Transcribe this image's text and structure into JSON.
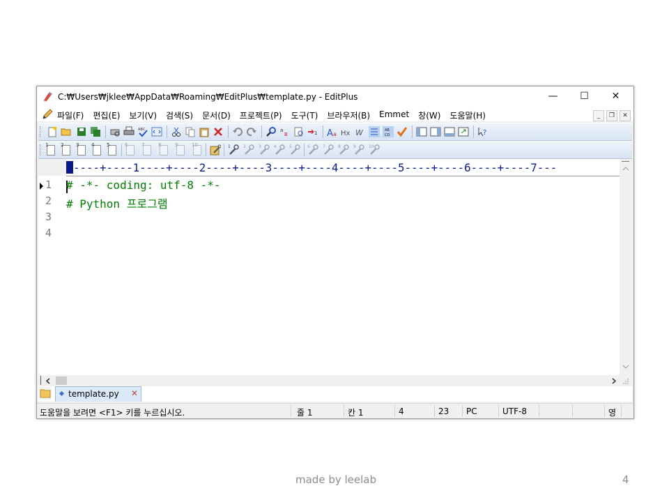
{
  "window": {
    "title": "C:₩Users₩jklee₩AppData₩Roaming₩EditPlus₩template.py - EditPlus",
    "controls": {
      "minimize": "—",
      "maximize": "☐",
      "close": "✕"
    }
  },
  "menubar": {
    "items": [
      "파일(F)",
      "편집(E)",
      "보기(V)",
      "검색(S)",
      "문서(D)",
      "프로젝트(P)",
      "도구(T)",
      "브라우저(B)",
      "Emmet",
      "창(W)",
      "도움말(H)"
    ],
    "mdi_controls": {
      "minimize": "_",
      "restore": "❐",
      "close": "✕"
    }
  },
  "toolbar2": {
    "doc_numbers": [
      "1",
      "2",
      "3",
      "4",
      "5",
      "6",
      "7",
      "8",
      "9",
      "10"
    ],
    "tool_numbers": [
      "1",
      "2",
      "3",
      "4",
      "5",
      "6",
      "7",
      "8",
      "9",
      "10"
    ]
  },
  "editor": {
    "ruler": "----+----1----+----2----+----3----+----4----+----5----+----6----+----7---",
    "line_numbers": [
      "1",
      "2",
      "3",
      "4"
    ],
    "lines": [
      "# -*- coding: utf-8 -*-",
      "# Python 프로그램",
      "",
      ""
    ]
  },
  "tabs": [
    {
      "label": "template.py"
    }
  ],
  "statusbar": {
    "help": "도움말을 보려면 <F1> 키를 누르십시오.",
    "line": "줄 1",
    "column": "칸 1",
    "lines_total": "4",
    "size": "23",
    "line_ending": "PC",
    "encoding": "UTF-8",
    "ime": "영"
  },
  "footer": {
    "made_by": "made by leelab",
    "page": "4"
  },
  "colors": {
    "code": "#008000",
    "ruler": "#0b1a8a",
    "line_numbers": "#7a7a7a"
  }
}
